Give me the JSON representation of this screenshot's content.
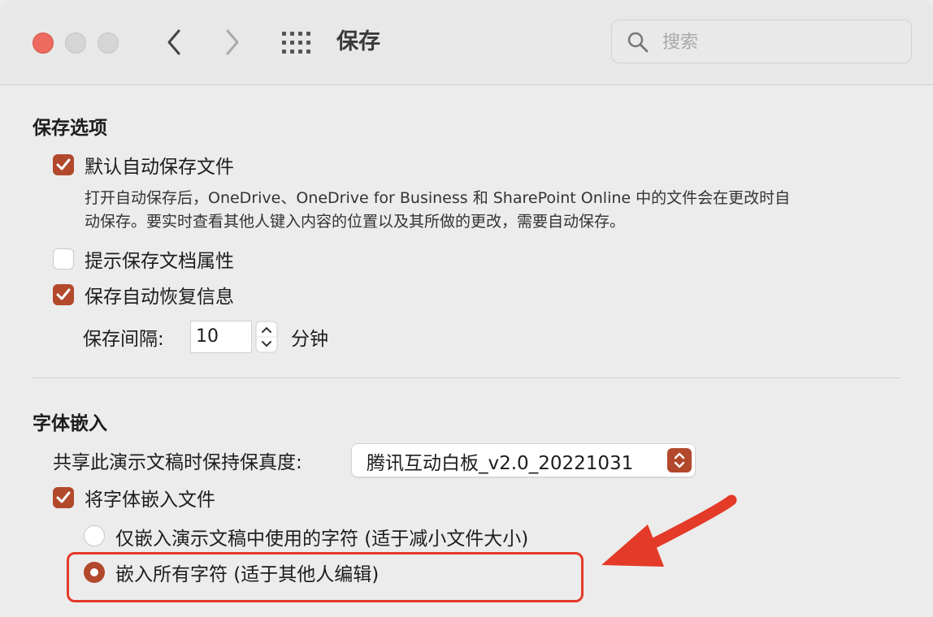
{
  "titlebar": {
    "title": "保存",
    "search_placeholder": "搜索"
  },
  "save_options": {
    "section_title": "保存选项",
    "autosave": {
      "label": "默认自动保存文件",
      "checked": true,
      "description_line1": "打开自动保存后，OneDrive、OneDrive for Business 和 SharePoint Online 中的文件会在更改时自",
      "description_line2": "动保存。要实时查看其他人键入内容的位置以及其所做的更改，需要自动保存。"
    },
    "prompt_properties": {
      "label": "提示保存文档属性",
      "checked": false
    },
    "autorecover": {
      "label": "保存自动恢复信息",
      "checked": true
    },
    "interval": {
      "label": "保存间隔:",
      "value": "10",
      "unit": "分钟"
    }
  },
  "font_embedding": {
    "section_title": "字体嵌入",
    "fidelity_label": "共享此演示文稿时保持保真度:",
    "fidelity_value": "腾讯互动白板_v2.0_20221031",
    "embed_fonts": {
      "label": "将字体嵌入文件",
      "checked": true
    },
    "option_used_chars": {
      "label": "仅嵌入演示文稿中使用的字符 (适于减小文件大小)",
      "selected": false
    },
    "option_all_chars": {
      "label": "嵌入所有字符 (适于其他人编辑)",
      "selected": true
    }
  },
  "colors": {
    "accent": "#b2482c",
    "annotation": "#e43a28"
  }
}
